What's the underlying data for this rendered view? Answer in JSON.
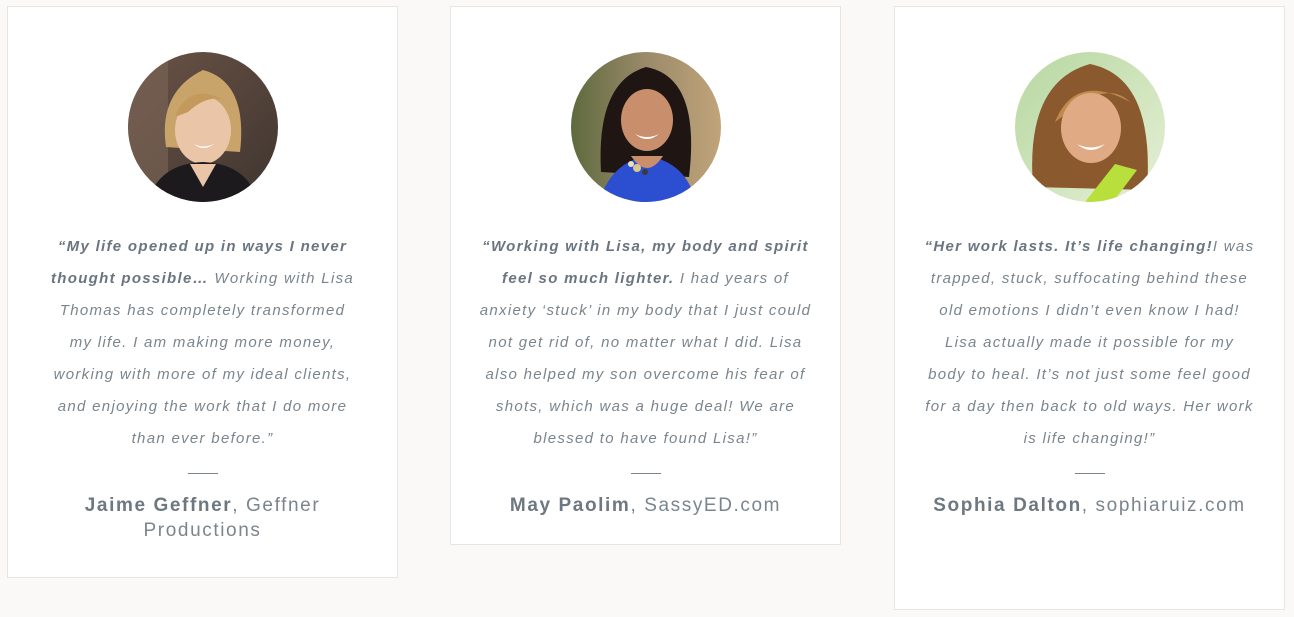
{
  "testimonials": [
    {
      "quote_lead": "“My life opened up in ways I never thought possible…",
      "quote_body": " Working with Lisa Thomas has completely transformed my life. I am making more money, working with more of my ideal clients, and enjoying the work that I do more than ever before.”",
      "name": "Jaime Geffner",
      "company": ", Geffner Productions"
    },
    {
      "quote_lead": "“Working with Lisa, my body and spirit feel so much lighter.",
      "quote_body": " I had years of anxiety ‘stuck’ in my body that I just could not get rid of, no matter what I did. Lisa also helped my son overcome his fear of shots, which was a huge deal! We are blessed to have found Lisa!”",
      "name": "May Paolim",
      "company": ", SassyED.com"
    },
    {
      "quote_lead": "“Her work lasts. It’s life changing!",
      "quote_body": "I was trapped, stuck, suffocating behind these old emotions I didn’t even know I had! Lisa actually made it possible for my body to heal. It’s not just some feel good for a day then back to old ways. Her work is life changing!”",
      "name": "Sophia Dalton",
      "company": ", sophiaruiz.com"
    }
  ]
}
